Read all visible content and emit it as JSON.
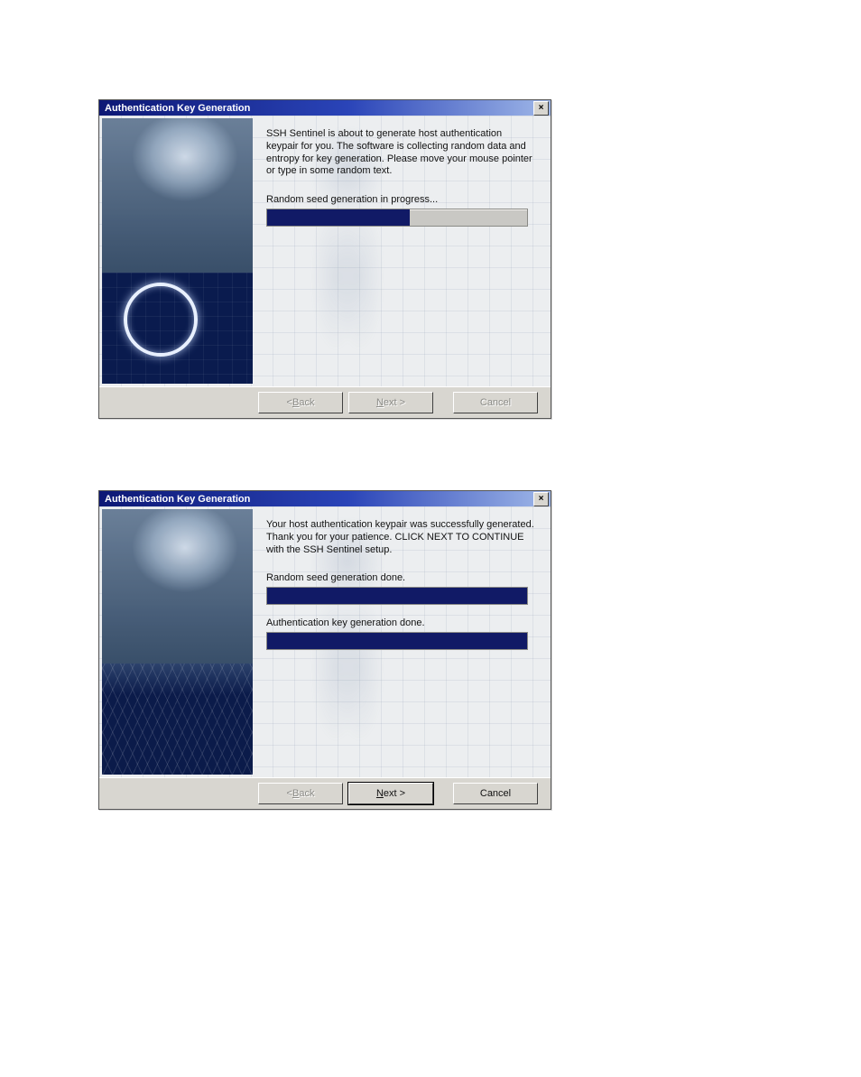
{
  "dialog1": {
    "title": "Authentication Key Generation",
    "close_glyph": "×",
    "description": "SSH Sentinel is about to generate host authentication keypair for you. The software is collecting random data and entropy for key generation. Please move your mouse pointer or type in some random text.",
    "seed_label": "Random seed generation in progress...",
    "seed_progress_pct": 55,
    "buttons": {
      "back": "< Back",
      "back_underline_index": 2,
      "next": "Next >",
      "next_underline_index": 0,
      "cancel": "Cancel",
      "back_enabled": false,
      "next_enabled": false,
      "cancel_enabled": false
    }
  },
  "dialog2": {
    "title": "Authentication Key Generation",
    "close_glyph": "×",
    "description": "Your host authentication keypair was successfully generated. Thank you for your patience. CLICK NEXT TO CONTINUE with the SSH Sentinel setup.",
    "seed_label": "Random seed generation done.",
    "seed_progress_pct": 100,
    "auth_label": "Authentication key generation done.",
    "auth_progress_pct": 100,
    "buttons": {
      "back": "< Back",
      "back_underline_index": 2,
      "next": "Next >",
      "next_underline_index": 0,
      "cancel": "Cancel",
      "back_enabled": false,
      "next_enabled": true,
      "cancel_enabled": true
    }
  }
}
